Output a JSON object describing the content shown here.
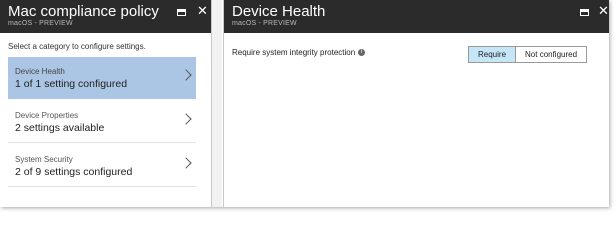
{
  "left_blade": {
    "title": "Mac compliance policy",
    "subtitle": "macOS - PREVIEW",
    "prompt": "Select a category to configure settings.",
    "items": [
      {
        "label": "Device Health",
        "value": "1 of 1 setting configured"
      },
      {
        "label": "Device Properties",
        "value": "2 settings available"
      },
      {
        "label": "System Security",
        "value": "2 of 9 settings configured"
      }
    ]
  },
  "right_blade": {
    "title": "Device Health",
    "subtitle": "macOS - PREVIEW",
    "setting": {
      "label": "Require system integrity protection",
      "options": [
        "Require",
        "Not configured"
      ],
      "selected": "Require"
    }
  },
  "icons": {
    "minimize": "minimize-icon",
    "close": "close-icon",
    "info": "info-icon",
    "chevron": "chevron-right-icon"
  },
  "colors": {
    "header_bg": "#2b2b2b",
    "selected_item": "#abc6e4",
    "active_toggle": "#c4e6f7"
  }
}
